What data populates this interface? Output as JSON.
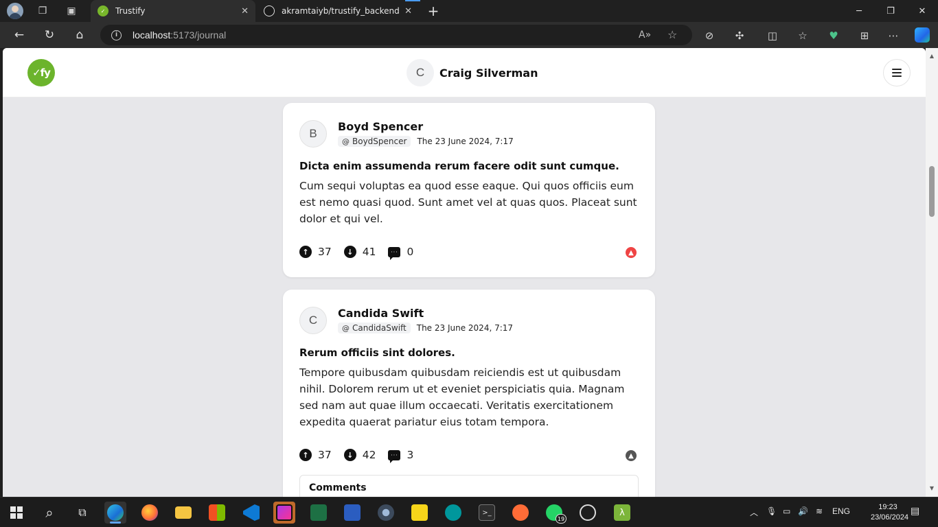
{
  "browser": {
    "tabs": [
      {
        "title": "Trustify",
        "favicon": "trustify-favicon"
      },
      {
        "title": "akramtaiyb/trustify_backend",
        "favicon": "github-icon"
      }
    ],
    "url": {
      "host": "localhost",
      "rest": ":5173/journal"
    }
  },
  "app": {
    "logo_text": "✓fy",
    "current_user": {
      "initial": "C",
      "name": "Craig Silverman"
    }
  },
  "posts": [
    {
      "initial": "B",
      "author": "Boyd Spencer",
      "handle": "BoydSpencer",
      "date": "The 23 June 2024, 7:17",
      "title": "Dicta enim assumenda rerum facere odit sunt cumque.",
      "body": "Cum sequi voluptas ea quod esse eaque. Qui quos officiis eum est nemo quasi quod. Sunt amet vel at quas quos. Placeat sunt dolor et qui vel.",
      "upvotes": "37",
      "downvotes": "41",
      "comments": "0",
      "trending_color": "#ef4444"
    },
    {
      "initial": "C",
      "author": "Candida Swift",
      "handle": "CandidaSwift",
      "date": "The 23 June 2024, 7:17",
      "title": "Rerum officiis sint dolores.",
      "body": "Tempore quibusdam quibusdam reiciendis est ut quibusdam nihil. Dolorem rerum ut et eveniet perspiciatis quia. Magnam sed nam aut quae illum occaecati. Veritatis exercitationem expedita quaerat pariatur eius totam tempora.",
      "upvotes": "37",
      "downvotes": "42",
      "comments": "3",
      "trending_color": "#555555",
      "comments_label": "Comments"
    }
  ],
  "taskbar": {
    "language": "ENG",
    "time": "19:23",
    "date": "23/06/2024",
    "whatsapp_badge": "19"
  },
  "colors": {
    "brand": "#6cb42c",
    "accent": "#60a5f5"
  }
}
